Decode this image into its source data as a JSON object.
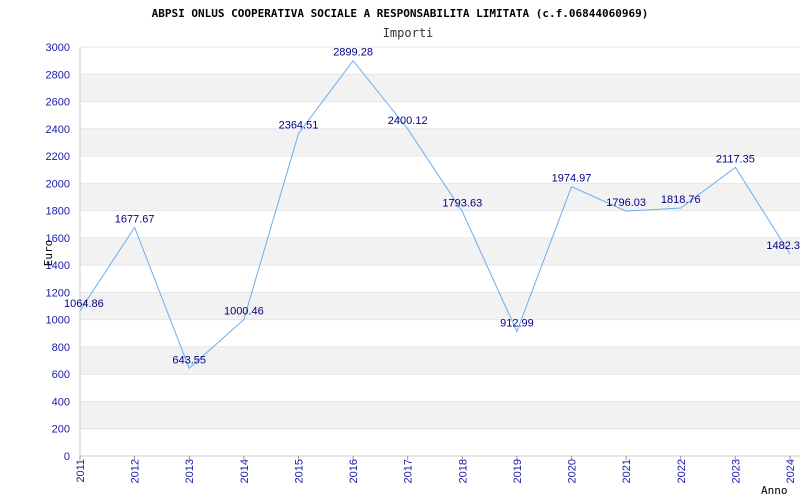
{
  "chart_data": {
    "type": "line",
    "title": "ABPSI ONLUS COOPERATIVA SOCIALE A RESPONSABILITA LIMITATA (c.f.06844060969)",
    "subtitle": "Importi",
    "xlabel": "Anno",
    "ylabel": "Euro",
    "categories": [
      "2011",
      "2012",
      "2013",
      "2014",
      "2015",
      "2016",
      "2017",
      "2018",
      "2019",
      "2020",
      "2021",
      "2022",
      "2023",
      "2024"
    ],
    "series": [
      {
        "values": [
          1064.86,
          1677.67,
          643.55,
          1000.46,
          2364.51,
          2899.28,
          2400.12,
          1793.63,
          912.99,
          1974.97,
          1796.03,
          1818.76,
          2117.35,
          1482.3
        ],
        "labels": [
          "1064.86",
          "1677.67",
          "643.55",
          "1000.46",
          "2364.51",
          "2899.28",
          "2400.12",
          "1793.63",
          "912.99",
          "1974.97",
          "1796.03",
          "1818.76",
          "2117.35",
          "1482.3"
        ]
      }
    ],
    "yticks": [
      "0",
      "200",
      "400",
      "600",
      "800",
      "1000",
      "1200",
      "1400",
      "1600",
      "1800",
      "2000",
      "2200",
      "2400",
      "2600",
      "2800",
      "3000"
    ],
    "ylim": [
      0,
      3000
    ],
    "grid": "horizontal bands",
    "colors": {
      "line": "#6aaef0",
      "band": "#f2f2f2",
      "tick_text": "#1a1aa6",
      "label_text": "#000080"
    }
  }
}
